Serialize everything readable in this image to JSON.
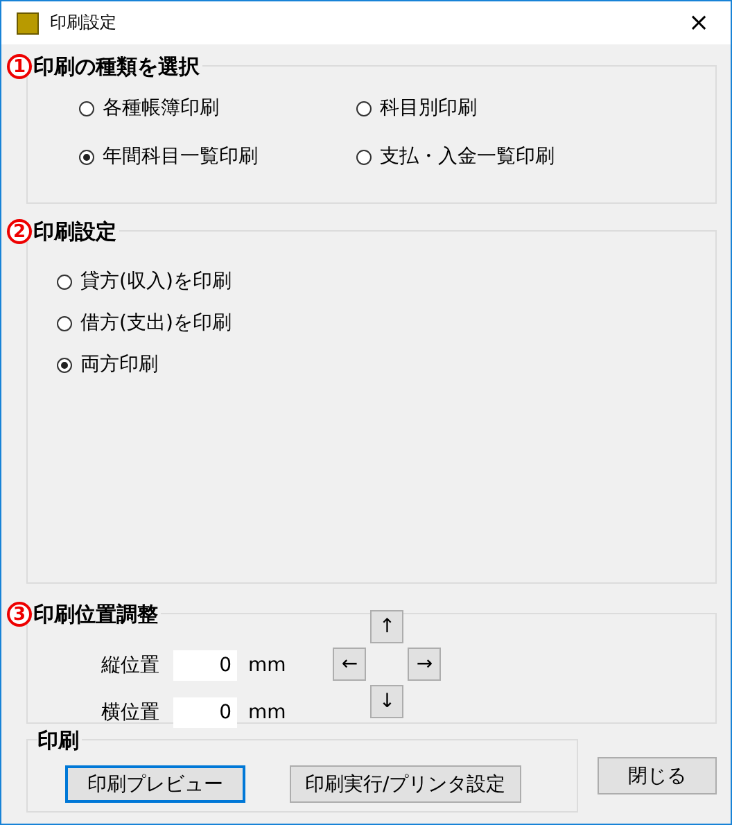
{
  "window": {
    "title": "印刷設定",
    "close": "×"
  },
  "sections": [
    {
      "number": "1",
      "title": "印刷の種類を選択",
      "kind": "grid",
      "options": [
        {
          "label": "各種帳簿印刷",
          "selected": false
        },
        {
          "label": "科目別印刷",
          "selected": false
        },
        {
          "label": "年間科目一覧印刷",
          "selected": true
        },
        {
          "label": "支払・入金一覧印刷",
          "selected": false
        }
      ]
    },
    {
      "number": "2",
      "title": "印刷設定",
      "kind": "list",
      "options": [
        {
          "label": "貸方(収入)を印刷",
          "selected": false
        },
        {
          "label": "借方(支出)を印刷",
          "selected": false
        },
        {
          "label": "両方印刷",
          "selected": true
        }
      ]
    },
    {
      "number": "3",
      "title": "印刷位置調整",
      "kind": "position",
      "fields": [
        {
          "label": "縦位置",
          "value": "0",
          "unit": "mm"
        },
        {
          "label": "横位置",
          "value": "0",
          "unit": "mm"
        }
      ],
      "arrows": {
        "up": "↑",
        "left": "←",
        "right": "→",
        "down": "↓"
      }
    }
  ],
  "print_group": {
    "title": "印刷",
    "buttons": [
      {
        "label": "印刷プレビュー",
        "focused": true
      },
      {
        "label": "印刷実行/プリンタ設定",
        "focused": false
      }
    ]
  },
  "close_button": "閉じる"
}
